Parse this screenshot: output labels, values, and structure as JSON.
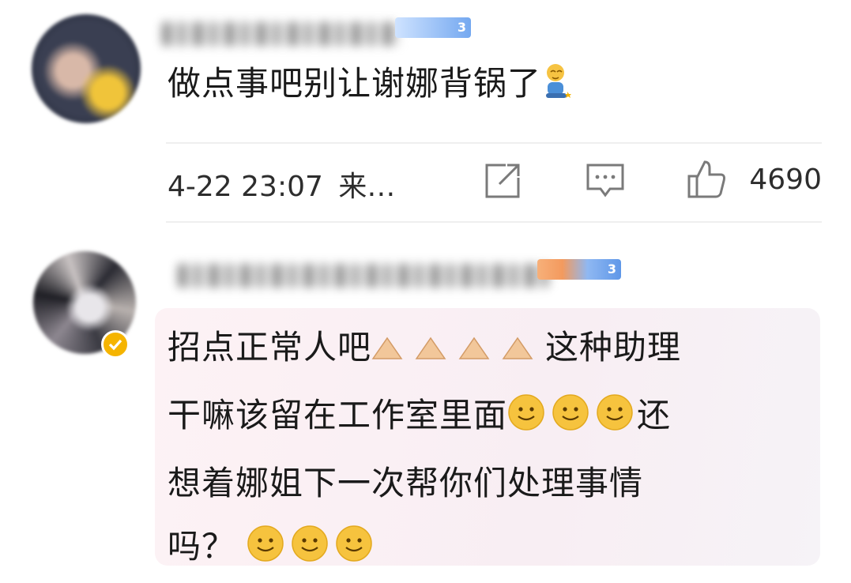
{
  "comments": [
    {
      "text": "做点事吧别让谢娜背锅了",
      "emoji": "sitting-person-emoji",
      "time": "4-22 23:07",
      "source": "来…",
      "like_count": "4690",
      "level_badge": "3"
    },
    {
      "lines": [
        "招点正常人吧",
        "这种助理",
        "干嘛该留在工作室里面",
        "还",
        "想着娜姐下一次帮你们处理事情",
        "吗？"
      ],
      "emoji_ok": "ok-hand-emoji",
      "emoji_smile": "smile-emoji",
      "level_badge": "3",
      "verified_icon": "verified-badge-icon"
    }
  ],
  "icons": {
    "share": "share-icon",
    "reply": "comment-icon",
    "like": "thumbs-up-icon"
  },
  "colors": {
    "text": "#1a1a1a",
    "meta": "#2d2d2d",
    "badge": "#74a8f0",
    "verified": "#f5b400",
    "highlight_bg": "#fdf2f5"
  }
}
